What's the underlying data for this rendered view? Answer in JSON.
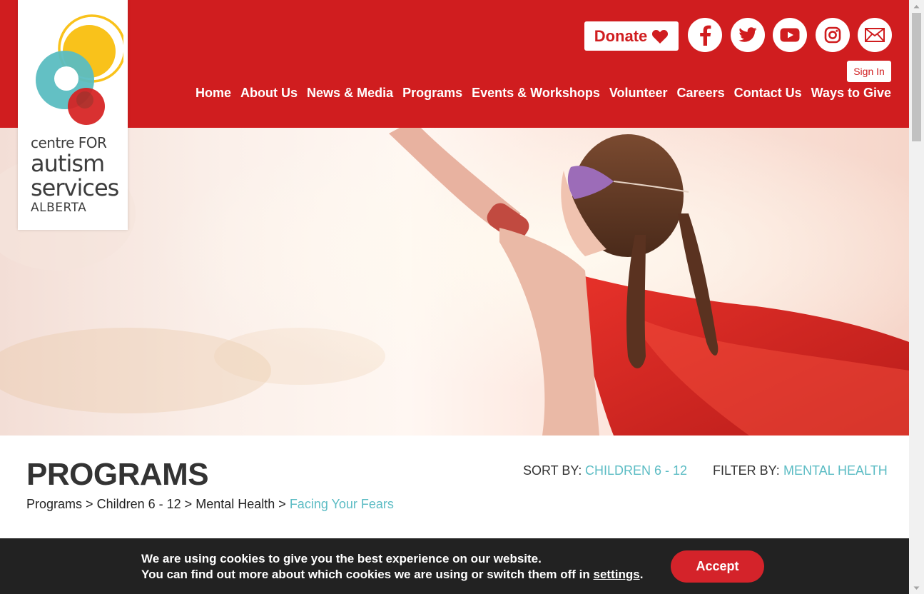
{
  "brand": {
    "logo_line1": "centre FOR",
    "logo_line2": "autism",
    "logo_line3": "services",
    "logo_line4": "ALBERTA",
    "primary_color": "#d01d1f",
    "accent_color": "#5cbcc4"
  },
  "header": {
    "donate_label": "Donate",
    "signin_label": "Sign In",
    "social": [
      "facebook-icon",
      "twitter-icon",
      "youtube-icon",
      "instagram-icon",
      "email-icon"
    ]
  },
  "nav": [
    "Home",
    "About Us",
    "News & Media",
    "Programs",
    "Events & Workshops",
    "Volunteer",
    "Careers",
    "Contact Us",
    "Ways to Give"
  ],
  "programs": {
    "title": "PROGRAMS",
    "sort_label": "SORT BY:",
    "sort_value": "CHILDREN 6 - 12",
    "filter_label": "FILTER BY:",
    "filter_value": "MENTAL HEALTH",
    "breadcrumb": [
      "Programs",
      "Children 6 - 12",
      "Mental Health",
      "Facing Your Fears"
    ],
    "separator": ">"
  },
  "cookie": {
    "line1": "We are using cookies to give you the best experience on our website.",
    "line2_prefix": "You can find out more about which cookies we are using or switch them off in",
    "settings_link": "settings",
    "line2_suffix": ".",
    "accept_label": "Accept"
  }
}
